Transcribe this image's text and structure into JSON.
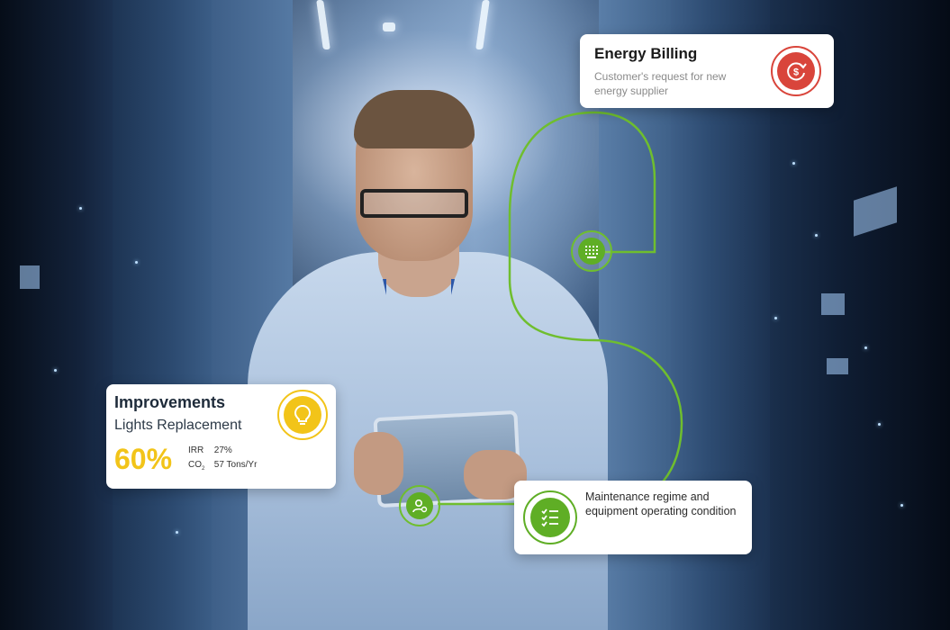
{
  "cards": {
    "energy_billing": {
      "title": "Energy Billing",
      "description": "Customer's request for new energy supplier",
      "icon": "dollar-refresh-icon"
    },
    "improvements": {
      "title": "Improvements",
      "subtitle": "Lights Replacement",
      "percentage": "60%",
      "irr_label": "IRR",
      "irr_value": "27%",
      "co2_label": "CO",
      "co2_sub": "2",
      "co2_value": "57 Tons/Yr",
      "icon": "lightbulb-icon"
    },
    "maintenance": {
      "description": "Maintenance regime and equipment operating condition",
      "icon": "checklist-icon"
    }
  },
  "nodes": [
    "building-grid-icon",
    "user-settings-icon"
  ],
  "colors": {
    "accent_green": "#6fbe2e",
    "node_green": "#5fae25",
    "billing_red": "#d9453b",
    "bulb_yellow": "#f2c419"
  }
}
